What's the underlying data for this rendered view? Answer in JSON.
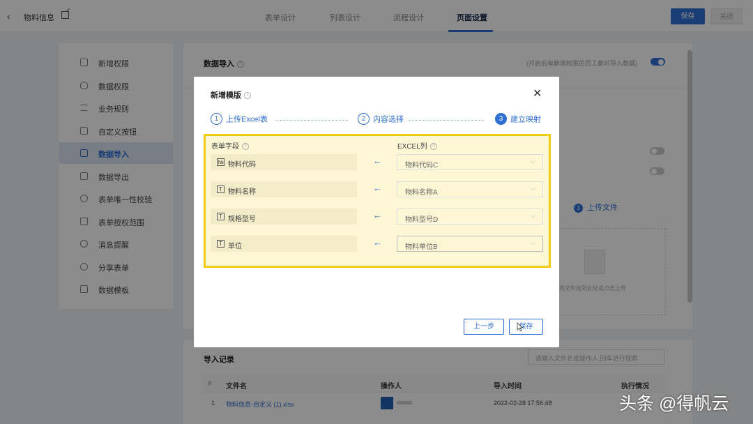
{
  "header": {
    "back_icon": "chevron-left-icon",
    "title": "物料信息",
    "edit_icon": "edit-icon",
    "tabs": [
      {
        "label": "表单设计",
        "active": false
      },
      {
        "label": "列表设计",
        "active": false
      },
      {
        "label": "流程设计",
        "active": false
      },
      {
        "label": "页面设置",
        "active": true
      }
    ],
    "save_label": "保存",
    "close_label": "关闭"
  },
  "sidebar": {
    "items": [
      {
        "label": "新增权限",
        "icon": "add-permission-icon",
        "active": false
      },
      {
        "label": "数据权限",
        "icon": "shield-icon",
        "active": false
      },
      {
        "label": "业务规则",
        "icon": "sliders-icon",
        "active": false
      },
      {
        "label": "自定义按钮",
        "icon": "custom-button-icon",
        "active": false
      },
      {
        "label": "数据导入",
        "icon": "import-icon",
        "active": true
      },
      {
        "label": "数据导出",
        "icon": "export-icon",
        "active": false
      },
      {
        "label": "表单唯一性校验",
        "icon": "unique-check-icon",
        "active": false
      },
      {
        "label": "表单授权范围",
        "icon": "auth-scope-icon",
        "active": false
      },
      {
        "label": "消息提醒",
        "icon": "alarm-icon",
        "active": false
      },
      {
        "label": "分享表单",
        "icon": "share-icon",
        "active": false
      },
      {
        "label": "数据模板",
        "icon": "template-icon",
        "active": false
      }
    ]
  },
  "main": {
    "section_title": "数据导入",
    "hint": "(开启后有新增权限的员工都可导入数据)",
    "toggle_on": true,
    "step3_num": "3",
    "step3_label": "上传文件",
    "upload_text": "将文件拖到此处或点击上传"
  },
  "records": {
    "title": "导入记录",
    "search_placeholder": "请输入文件名或操作人,回车进行搜索",
    "columns": [
      "#",
      "文件名",
      "操作人",
      "导入时间",
      "执行情况"
    ],
    "rows": [
      {
        "index": "1",
        "file": "物料信息-自定义 (1).xlsx",
        "time": "2022-02-28 17:56:48"
      }
    ]
  },
  "modal": {
    "title": "新增模版",
    "close_icon": "close-icon",
    "steps": [
      {
        "num": "1",
        "label": "上传Excel表",
        "current": false
      },
      {
        "num": "2",
        "label": "内容选择",
        "current": false
      },
      {
        "num": "3",
        "label": "建立映射",
        "current": true
      }
    ],
    "col_form_field": "表单字段",
    "col_excel": "EXCEL列",
    "mappings": [
      {
        "field": "物料代码",
        "field_icon": "serial-number-icon",
        "icon_glyph": "№",
        "excel": "物料代码C"
      },
      {
        "field": "物料名称",
        "field_icon": "text-field-icon",
        "icon_glyph": "T",
        "excel": "物料名称A"
      },
      {
        "field": "规格型号",
        "field_icon": "text-field-icon",
        "icon_glyph": "T",
        "excel": "物料型号D"
      },
      {
        "field": "单位",
        "field_icon": "text-field-icon",
        "icon_glyph": "T",
        "excel": "物料单位B"
      }
    ],
    "prev_label": "上一步",
    "save_label": "保存"
  },
  "watermark": "头条 @得帆云",
  "colors": {
    "primary": "#2f6fd4",
    "highlight_border": "#f5cc14",
    "highlight_fill": "#fdf7d6"
  }
}
